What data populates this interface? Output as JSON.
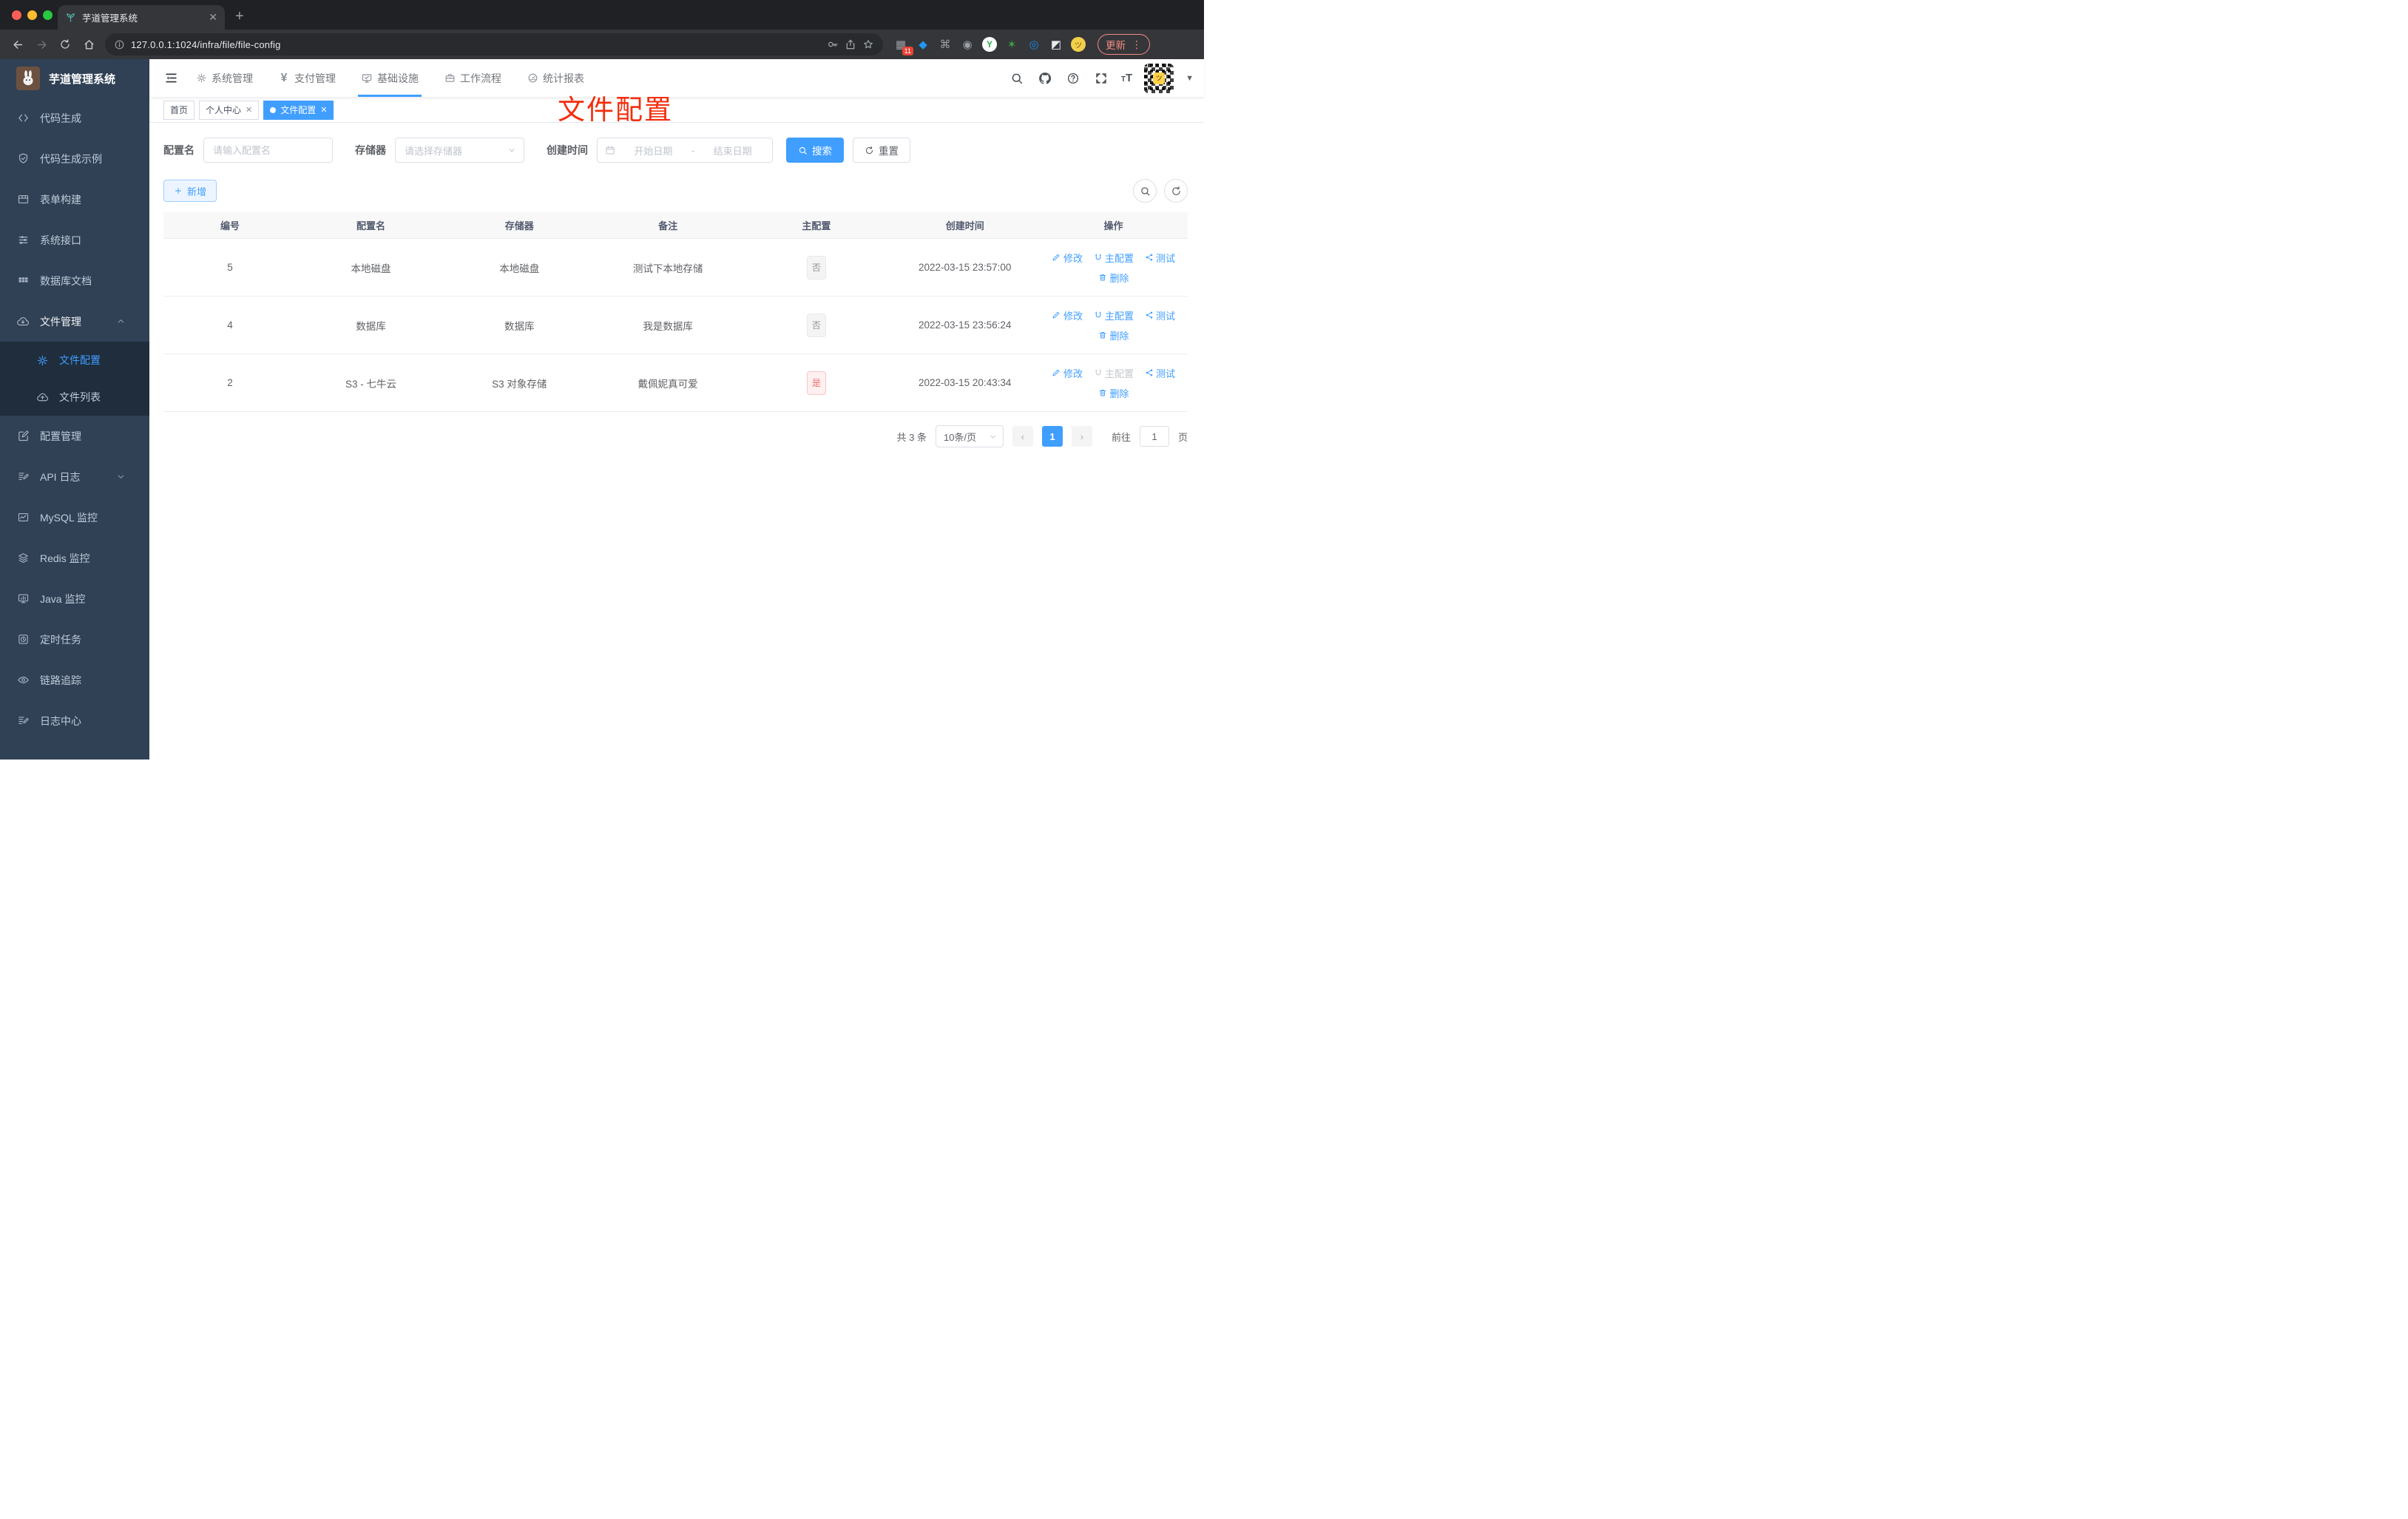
{
  "colors": {
    "accent": "#409eff",
    "annotation_red": "#f42e0d",
    "sidebar_bg": "#304156",
    "submenu_bg": "#1f2d3d"
  },
  "browser": {
    "tab_title": "芋道管理系统",
    "url": "127.0.0.1:1024/infra/file/file-config",
    "ext_badge": "11",
    "update_label": "更新"
  },
  "sidebar": {
    "title": "芋道管理系统",
    "items": [
      {
        "label": "代码生成",
        "icon": "code-icon"
      },
      {
        "label": "代码生成示例",
        "icon": "shield-check-icon"
      },
      {
        "label": "表单构建",
        "icon": "form-icon"
      },
      {
        "label": "系统接口",
        "icon": "sliders-icon"
      },
      {
        "label": "数据库文档",
        "icon": "table-grid-icon"
      },
      {
        "label": "文件管理",
        "icon": "cloud-download-icon",
        "expanded": true,
        "children": [
          {
            "label": "文件配置",
            "icon": "gear-icon",
            "active": true
          },
          {
            "label": "文件列表",
            "icon": "cloud-upload-icon"
          }
        ]
      },
      {
        "label": "配置管理",
        "icon": "edit-square-icon"
      },
      {
        "label": "API 日志",
        "icon": "doc-log-icon",
        "collapsed": true
      },
      {
        "label": "MySQL 监控",
        "icon": "chart-icon"
      },
      {
        "label": "Redis 监控",
        "icon": "layers-icon"
      },
      {
        "label": "Java 监控",
        "icon": "monitor-icon"
      },
      {
        "label": "定时任务",
        "icon": "timer-icon"
      },
      {
        "label": "链路追踪",
        "icon": "eye-icon"
      },
      {
        "label": "日志中心",
        "icon": "doc-log-icon"
      }
    ]
  },
  "topnav": {
    "items": [
      {
        "label": "系统管理",
        "icon": "gear-icon"
      },
      {
        "label": "支付管理",
        "icon": "yen-icon"
      },
      {
        "label": "基础设施",
        "icon": "infra-icon",
        "active": true
      },
      {
        "label": "工作流程",
        "icon": "briefcase-icon"
      },
      {
        "label": "统计报表",
        "icon": "gauge-icon"
      }
    ]
  },
  "tabs": {
    "items": [
      {
        "label": "首页"
      },
      {
        "label": "个人中心",
        "closable": true
      },
      {
        "label": "文件配置",
        "closable": true,
        "active": true
      }
    ]
  },
  "annotation": {
    "text": "文件配置"
  },
  "filters": {
    "name_label": "配置名",
    "name_placeholder": "请输入配置名",
    "storage_label": "存储器",
    "storage_placeholder": "请选择存储器",
    "created_label": "创建时间",
    "start_placeholder": "开始日期",
    "range_separator": "-",
    "end_placeholder": "结束日期",
    "search_label": "搜索",
    "reset_label": "重置"
  },
  "toolbar": {
    "add_label": "新增"
  },
  "table": {
    "headers": [
      "编号",
      "配置名",
      "存储器",
      "备注",
      "主配置",
      "创建时间",
      "操作"
    ],
    "rows": [
      {
        "id": "5",
        "name": "本地磁盘",
        "storage": "本地磁盘",
        "remark": "测试下本地存储",
        "master_label": "否",
        "master_type": "info",
        "created": "2022-03-15 23:57:00",
        "actions": {
          "edit": "修改",
          "master": "主配置",
          "test": "测试",
          "remove": "删除",
          "master_disabled": false
        }
      },
      {
        "id": "4",
        "name": "数据库",
        "storage": "数据库",
        "remark": "我是数据库",
        "master_label": "否",
        "master_type": "info",
        "created": "2022-03-15 23:56:24",
        "actions": {
          "edit": "修改",
          "master": "主配置",
          "test": "测试",
          "remove": "删除",
          "master_disabled": false
        }
      },
      {
        "id": "2",
        "name": "S3 - 七牛云",
        "storage": "S3 对象存储",
        "remark": "戴佩妮真可爱",
        "master_label": "是",
        "master_type": "danger",
        "created": "2022-03-15 20:43:34",
        "actions": {
          "edit": "修改",
          "master": "主配置",
          "test": "测试",
          "remove": "删除",
          "master_disabled": true
        }
      }
    ]
  },
  "pagination": {
    "total": "共 3 条",
    "page_size": "10条/页",
    "page": "1",
    "goto_label": "前往",
    "goto_value": "1",
    "unit": "页"
  }
}
